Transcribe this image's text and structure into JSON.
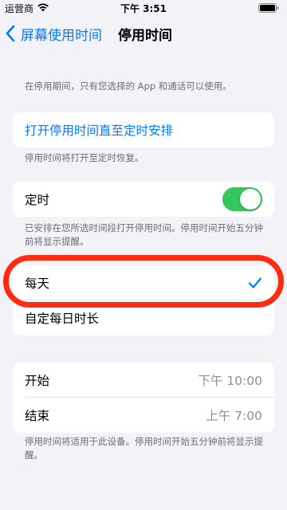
{
  "status_bar": {
    "carrier": "运营商",
    "time": "下午 3:51"
  },
  "nav": {
    "back_label": "屏幕使用时间",
    "title": "停用时间"
  },
  "intro_note": "在停用期间，只有您选择的 App 和通话可以使用。",
  "turn_on_until_schedule": {
    "label": "打开停用时间直至定时安排"
  },
  "turn_on_note": "停用时间将打开至定时恢复。",
  "scheduled": {
    "label": "定时",
    "enabled": true
  },
  "scheduled_note": "已安排在您所选时间段打开停用时间。停用时间开始五分钟前将显示提醒。",
  "frequency": {
    "options": [
      {
        "label": "每天",
        "selected": true
      },
      {
        "label": "自定每日时长",
        "selected": false
      }
    ]
  },
  "times": {
    "start_label": "开始",
    "start_value": "下午 10:00",
    "end_label": "结束",
    "end_value": "上午 7:00"
  },
  "device_note": "停用时间将适用于此设备。停用时间开始五分钟前将显示提醒。",
  "colors": {
    "accent": "#007aff",
    "toggle_on": "#34c759",
    "highlight": "#ff2a12",
    "background": "#f2f2f7"
  }
}
